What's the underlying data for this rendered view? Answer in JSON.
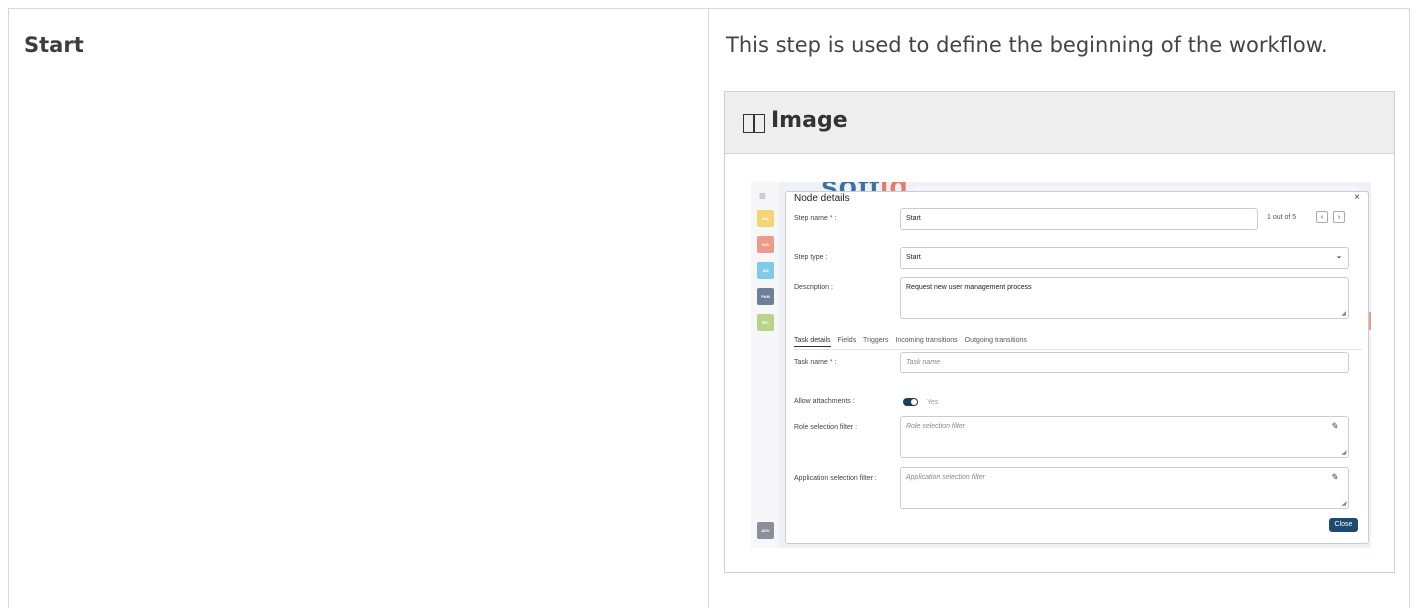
{
  "left_cell": {
    "title": "Start"
  },
  "right_cell": {
    "description": "This step is used to define the beginning of the workflow.",
    "image_box_title": "Image"
  },
  "screenshot": {
    "logo_main": "soff",
    "logo_accent": "id",
    "rail_badges": [
      {
        "label": "IGA",
        "color": "#f2d675"
      },
      {
        "label": "IGA",
        "color": "#ee9a8a"
      },
      {
        "label": "AM",
        "color": "#7fcbe8"
      },
      {
        "label": "PAM",
        "color": "#6b7f99"
      },
      {
        "label": "IRC",
        "color": "#b8d48a"
      },
      {
        "label": "ADV",
        "color": "#8a8f99"
      }
    ],
    "dialog": {
      "title": "Node details",
      "close_x": "×",
      "step_name_label": "Step name",
      "step_name_value": "Start",
      "pager_text": "1 out of 5",
      "prev": "‹",
      "next": "›",
      "step_type_label": "Step type :",
      "step_type_value": "Start",
      "description_label": "Description :",
      "description_value": "Request new user management process",
      "tabs": [
        "Task details",
        "Fields",
        "Triggers",
        "Incoming transitions",
        "Outgoing transitions"
      ],
      "task_name_label": "Task name",
      "task_name_placeholder": "Task name",
      "allow_attachments_label": "Allow attachments :",
      "allow_attachments_value": "Yes",
      "role_filter_label": "Role selection filter :",
      "role_filter_placeholder": "Role selection filter",
      "app_filter_label": "Application selection filter :",
      "app_filter_placeholder": "Application selection filter",
      "close_button": "Close"
    }
  }
}
